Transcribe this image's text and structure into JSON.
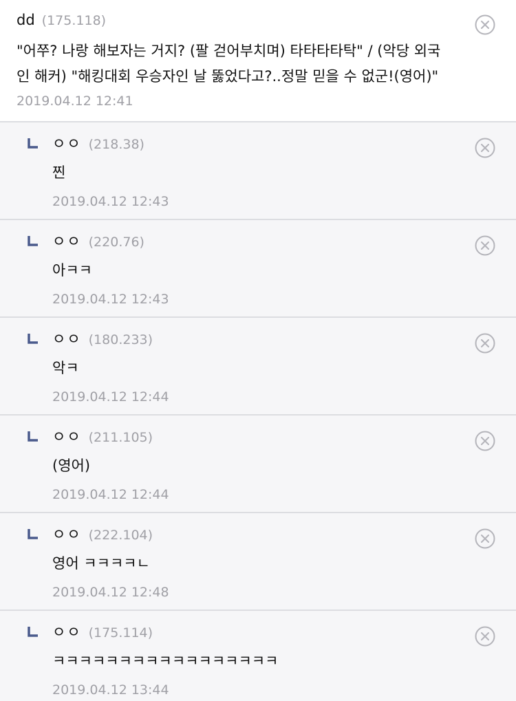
{
  "colors": {
    "text": "#111111",
    "meta": "#a0a0a6",
    "reply_background": "#f6f6f8",
    "divider": "#dcdde1",
    "reply_marker": "#4a5a8c",
    "delete_icon": "#b4b4ba"
  },
  "icons": {
    "delete": "circle-x-icon",
    "reply_marker": "reply-corner-icon"
  },
  "main_comment": {
    "nickname": "dd",
    "ip": "(175.118)",
    "body_line_1": "\"어쭈? 나랑 해보자는 거지? (팔 걷어부치며) 타타타타탁\" / (악당 외국",
    "body_line_2": "인 해커) \"해킹대회 우승자인 날 뚫었다고?..정말 믿을 수 없군!(영어)\"",
    "timestamp": "2019.04.12 12:41"
  },
  "replies": [
    {
      "nickname": "ㅇㅇ",
      "ip": "(218.38)",
      "body": "찐",
      "timestamp": "2019.04.12 12:43"
    },
    {
      "nickname": "ㅇㅇ",
      "ip": "(220.76)",
      "body": "아ㅋㅋ",
      "timestamp": "2019.04.12 12:43"
    },
    {
      "nickname": "ㅇㅇ",
      "ip": "(180.233)",
      "body": "악ㅋ",
      "timestamp": "2019.04.12 12:44"
    },
    {
      "nickname": "ㅇㅇ",
      "ip": "(211.105)",
      "body": "(영어)",
      "timestamp": "2019.04.12 12:44"
    },
    {
      "nickname": "ㅇㅇ",
      "ip": "(222.104)",
      "body": "영어 ㅋㅋㅋㅋㄴ",
      "timestamp": "2019.04.12 12:48"
    },
    {
      "nickname": "ㅇㅇ",
      "ip": "(175.114)",
      "body": "ㅋㅋㅋㅋㅋㅋㅋㅋㅋㅋㅋㅋㅋㅋㅋㅋㅋ",
      "timestamp": "2019.04.12 13:44"
    }
  ]
}
